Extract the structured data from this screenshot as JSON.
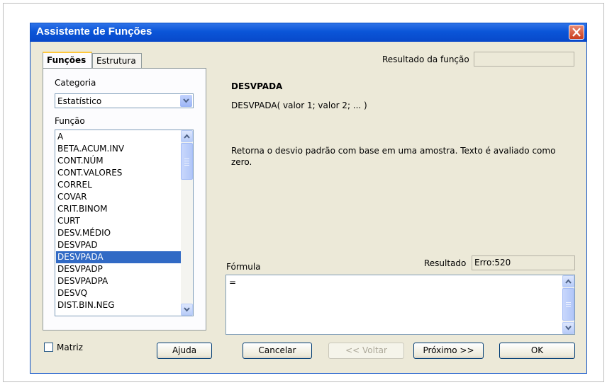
{
  "window": {
    "title": "Assistente de Funções"
  },
  "tabs": [
    {
      "label": "Funções",
      "active": true
    },
    {
      "label": "Estrutura",
      "active": false
    }
  ],
  "category": {
    "label": "Categoria",
    "value": "Estatístico"
  },
  "functions": {
    "label": "Função",
    "items": [
      "A",
      "BETA.ACUM.INV",
      "CONT.NÚM",
      "CONT.VALORES",
      "CORREL",
      "COVAR",
      "CRIT.BINOM",
      "CURT",
      "DESV.MÉDIO",
      "DESVPAD",
      "DESVPADA",
      "DESVPADP",
      "DESVPADPA",
      "DESVQ",
      "DIST.BIN.NEG"
    ],
    "selected": "DESVPADA"
  },
  "function_result": {
    "label": "Resultado da função",
    "value": ""
  },
  "detail": {
    "name": "DESVPADA",
    "syntax": "DESVPADA( valor 1; valor 2; ... )",
    "description": "Retorna o desvio padrão com base em uma amostra. Texto é avaliado como zero."
  },
  "formula": {
    "label": "Fórmula",
    "value": "=",
    "result_label": "Resultado",
    "result_value": "Erro:520"
  },
  "matrix": {
    "label": "Matriz",
    "checked": false
  },
  "buttons": {
    "help": "Ajuda",
    "cancel": "Cancelar",
    "back": "<< Voltar",
    "next": "Próximo >>",
    "ok": "OK"
  },
  "colors": {
    "titlebar": "#0a55d8",
    "selection": "#316ac5",
    "dialog_bg": "#ece9d8",
    "close_button": "#c93d1d"
  }
}
